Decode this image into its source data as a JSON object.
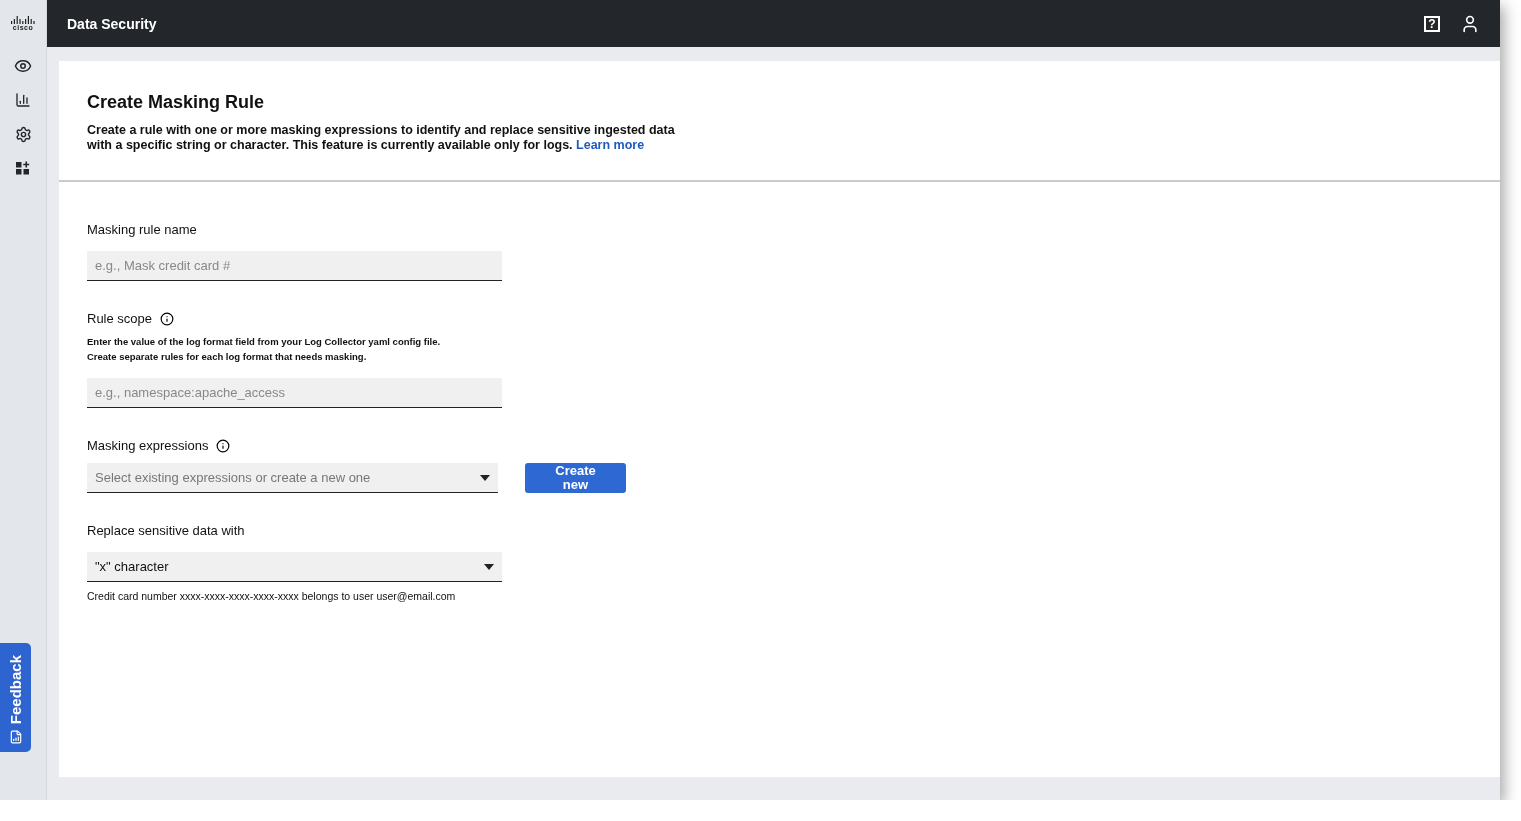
{
  "logo": {
    "text": "cisco"
  },
  "top_bar": {
    "title": "Data Security",
    "help": "?"
  },
  "sidebar": {
    "items": [
      {
        "kind": "eye",
        "selected": false
      },
      {
        "kind": "chart",
        "selected": false
      },
      {
        "kind": "gear",
        "selected": false
      },
      {
        "kind": "grid",
        "selected": false
      }
    ]
  },
  "feedback": {
    "label": "Feedback"
  },
  "header": {
    "title": "Create Masking Rule",
    "description": "Create a rule with one or more masking expressions to identify and replace sensitive ingested data with a specific string or character. This feature is currently available only for logs.",
    "link": "Learn more"
  },
  "form": {
    "name": {
      "label": "Masking rule name",
      "placeholder": "e.g., Mask credit card #"
    },
    "scope": {
      "label": "Rule scope",
      "help": [
        "Enter the value of the log format field from your Log Collector yaml config file.",
        "Create separate rules for each log format that needs masking."
      ],
      "placeholder": "e.g., namespace:apache_access"
    },
    "expressions": {
      "label": "Masking expressions",
      "placeholder": "Select existing expressions or create a new one",
      "button": "Create new"
    },
    "replace": {
      "label": "Replace sensitive data with",
      "value": "\"x\" character",
      "example": "Credit card number xxxx-xxxx-xxxx-xxxx-xxxx belongs to user user@email.com"
    }
  }
}
